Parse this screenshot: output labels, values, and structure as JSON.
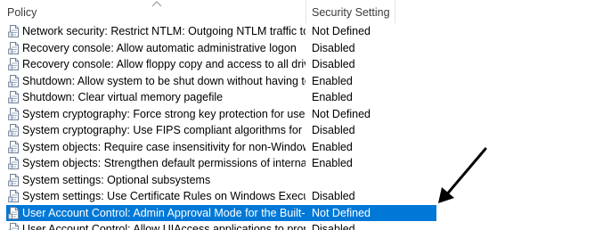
{
  "columns": {
    "policy": "Policy",
    "setting": "Security Setting"
  },
  "rows": [
    {
      "policy": "Network security: Restrict NTLM: Outgoing NTLM traffic to r...",
      "setting": "Not Defined",
      "selected": false
    },
    {
      "policy": "Recovery console: Allow automatic administrative logon",
      "setting": "Disabled",
      "selected": false
    },
    {
      "policy": "Recovery console: Allow floppy copy and access to all drives...",
      "setting": "Disabled",
      "selected": false
    },
    {
      "policy": "Shutdown: Allow system to be shut down without having to...",
      "setting": "Enabled",
      "selected": false
    },
    {
      "policy": "Shutdown: Clear virtual memory pagefile",
      "setting": "Enabled",
      "selected": false
    },
    {
      "policy": "System cryptography: Force strong key protection for user k...",
      "setting": "Not Defined",
      "selected": false
    },
    {
      "policy": "System cryptography: Use FIPS compliant algorithms for en...",
      "setting": "Disabled",
      "selected": false
    },
    {
      "policy": "System objects: Require case insensitivity for non-Windows ...",
      "setting": "Enabled",
      "selected": false
    },
    {
      "policy": "System objects: Strengthen default permissions of internal s...",
      "setting": "Enabled",
      "selected": false
    },
    {
      "policy": "System settings: Optional subsystems",
      "setting": "",
      "selected": false
    },
    {
      "policy": "System settings: Use Certificate Rules on Windows Executab...",
      "setting": "Disabled",
      "selected": false
    },
    {
      "policy": "User Account Control: Admin Approval Mode for the Built-i...",
      "setting": "Not Defined",
      "selected": true
    },
    {
      "policy": "User Account Control: Allow UIAccess applications to prom...",
      "setting": "Disabled",
      "selected": false
    }
  ],
  "colors": {
    "selection": "#0078d7",
    "arrow": "#000000"
  },
  "icons": {
    "row": "policy-document-icon",
    "header": "sort-ascending-caret-icon",
    "annotation": "arrow-annotation"
  }
}
